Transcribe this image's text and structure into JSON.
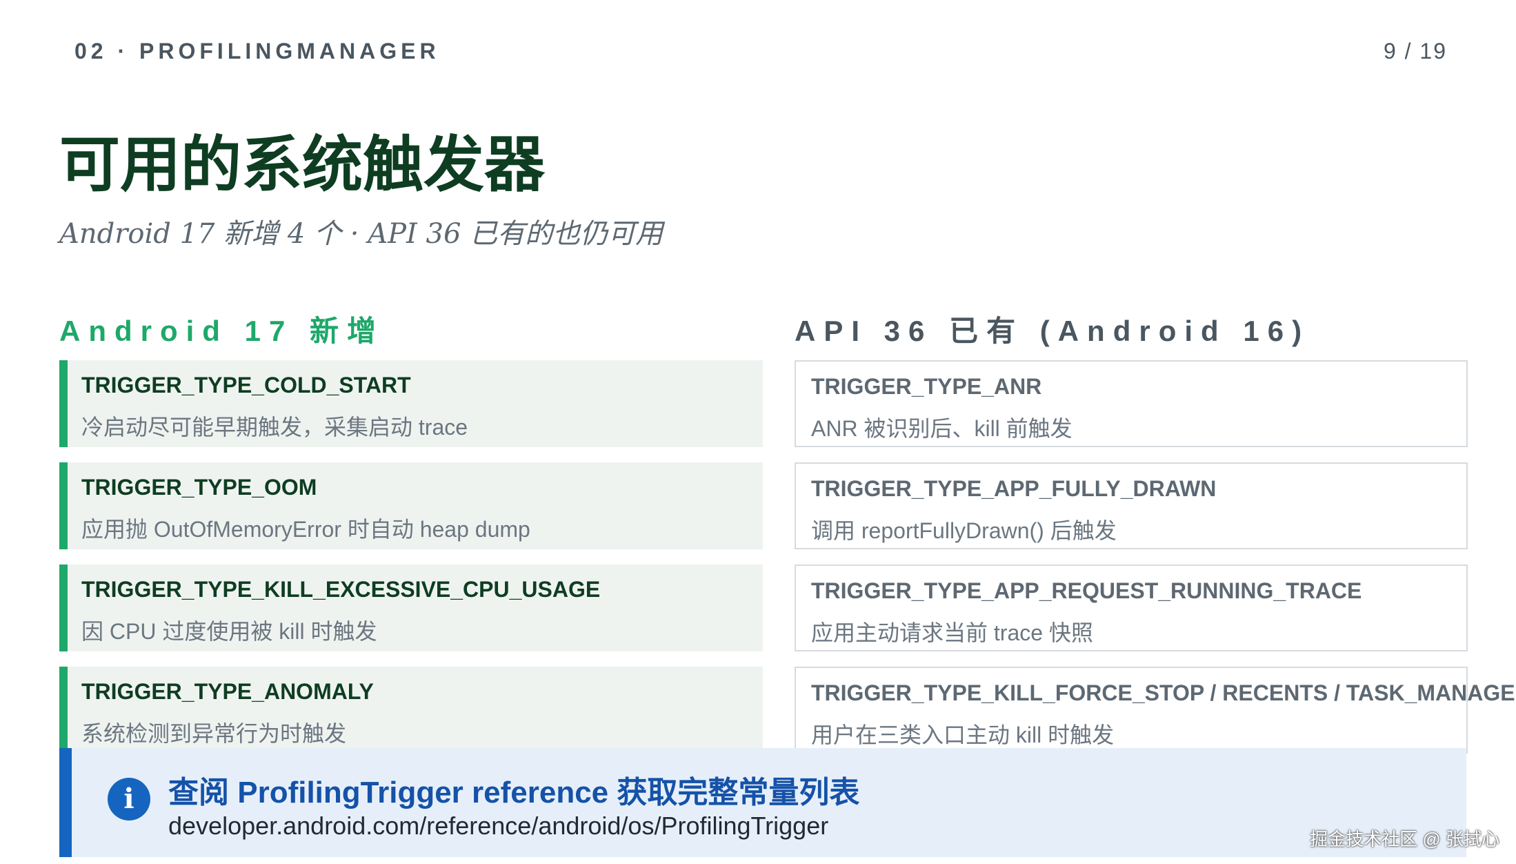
{
  "header": {
    "section": "02 · PROFILINGMANAGER",
    "page": "9 / 19"
  },
  "title": "可用的系统触发器",
  "subtitle": "Android 17 新增 4 个 · API 36 已有的也仍可用",
  "columns": {
    "left_heading": "Android 17 新增",
    "right_heading": "API 36 已有 (Android 16)"
  },
  "new_triggers": [
    {
      "name": "TRIGGER_TYPE_COLD_START",
      "desc": "冷启动尽可能早期触发，采集启动 trace"
    },
    {
      "name": "TRIGGER_TYPE_OOM",
      "desc": "应用抛 OutOfMemoryError 时自动 heap dump"
    },
    {
      "name": "TRIGGER_TYPE_KILL_EXCESSIVE_CPU_USAGE",
      "desc": "因 CPU 过度使用被 kill 时触发"
    },
    {
      "name": "TRIGGER_TYPE_ANOMALY",
      "desc": "系统检测到异常行为时触发"
    }
  ],
  "existing_triggers": [
    {
      "name": "TRIGGER_TYPE_ANR",
      "desc": "ANR 被识别后、kill 前触发"
    },
    {
      "name": "TRIGGER_TYPE_APP_FULLY_DRAWN",
      "desc": "调用 reportFullyDrawn() 后触发"
    },
    {
      "name": "TRIGGER_TYPE_APP_REQUEST_RUNNING_TRACE",
      "desc": "应用主动请求当前 trace 快照"
    },
    {
      "name": "TRIGGER_TYPE_KILL_FORCE_STOP / RECENTS / TASK_MANAGER",
      "desc": "用户在三类入口主动 kill 时触发"
    }
  ],
  "info": {
    "icon": "info-icon",
    "title": "查阅 ProfilingTrigger reference 获取完整常量列表",
    "url": "developer.android.com/reference/android/os/ProfilingTrigger"
  },
  "watermark": "掘金技术社区 @ 张拭心",
  "colors": {
    "accent_green": "#1ea86a",
    "title_green": "#0e3d22",
    "info_blue": "#1565c0"
  }
}
